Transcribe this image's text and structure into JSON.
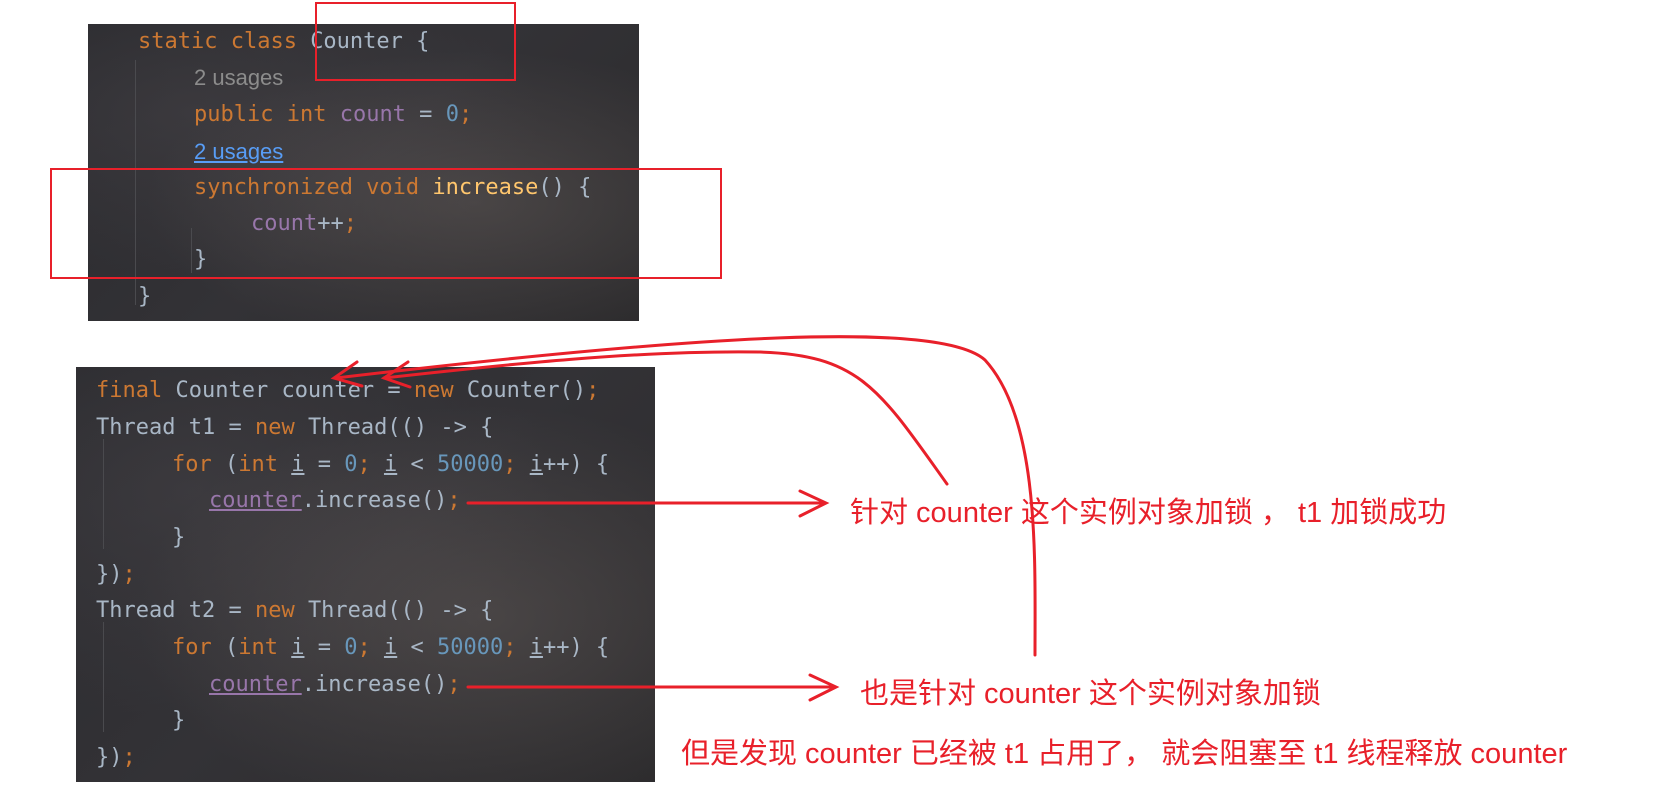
{
  "class_snippet": {
    "line1": {
      "kw": "static class ",
      "name": "Counter",
      "rest": " {"
    },
    "hint1": "2 usages",
    "line2": {
      "kw1": "public ",
      "kw2": "int ",
      "field": "count",
      "eq": " = ",
      "num": "0",
      "semi": ";"
    },
    "hint2": "2 usages",
    "line3": {
      "kw": "synchronized void ",
      "fn": "increase",
      "rest": "() {"
    },
    "line4": {
      "field": "count",
      "rest": "++",
      "semi": ";"
    },
    "line5": "}",
    "line6": "}"
  },
  "main_snippet": {
    "l1": {
      "kw": "final ",
      "type": "Counter counter = ",
      "new": "new ",
      "ctor": "Counter()",
      "semi": ";"
    },
    "l2": {
      "a": "Thread t1 = ",
      "new": "new ",
      "b": "Thread(() -> {"
    },
    "l3": {
      "kw": "for ",
      "a": "(",
      "int": "int ",
      "i1": "i",
      "b": " = ",
      "n0": "0",
      "s1": "; ",
      "i2": "i",
      "c": " < ",
      "n1": "50000",
      "s2": "; ",
      "i3": "i",
      "d": "++) {"
    },
    "l4": {
      "obj": "counter",
      "call": ".increase()",
      "semi": ";"
    },
    "l5": "}",
    "l6": {
      "a": "})",
      "semi": ";"
    },
    "l7": {
      "a": "Thread t2 = ",
      "new": "new ",
      "b": "Thread(() -> {"
    },
    "l8": {
      "kw": "for ",
      "a": "(",
      "int": "int ",
      "i1": "i",
      "b": " = ",
      "n0": "0",
      "s1": "; ",
      "i2": "i",
      "c": " < ",
      "n1": "50000",
      "s2": "; ",
      "i3": "i",
      "d": "++) {"
    },
    "l9": {
      "obj": "counter",
      "call": ".increase()",
      "semi": ";"
    },
    "l10": "}",
    "l11": {
      "a": "})",
      "semi": ";"
    }
  },
  "annotations": {
    "note1": "针对 counter 这个实例对象加锁 ， t1 加锁成功",
    "note2": "也是针对 counter 这个实例对象加锁",
    "note3": "但是发现 counter 已经被 t1 占用了， 就会阻塞至 t1 线程释放 counter"
  },
  "colors": {
    "annotation_red": "#e8202a",
    "keyword": "#cc7832",
    "field": "#9876aa",
    "number": "#6897bb",
    "method": "#ffc66d",
    "text": "#a9b7c6"
  }
}
